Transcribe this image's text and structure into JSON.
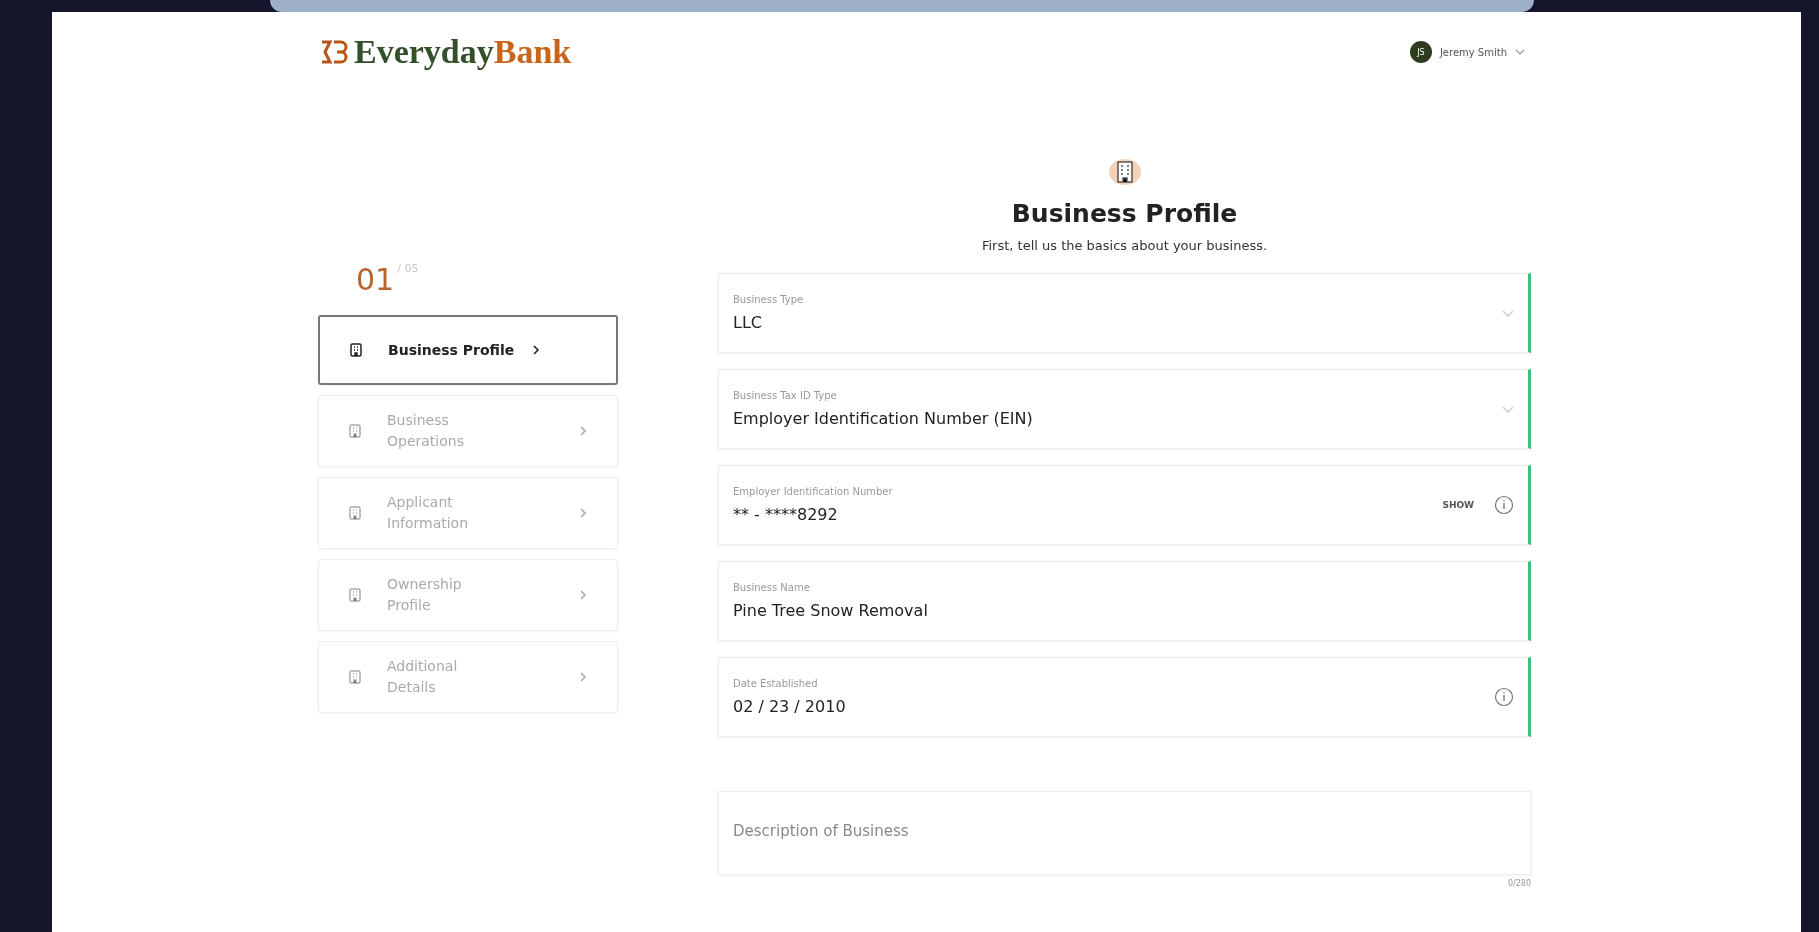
{
  "header": {
    "brand": {
      "first": "Everyday",
      "second": "Bank"
    },
    "user": {
      "initials": "JS",
      "name": "Jeremy Smith"
    }
  },
  "progress": {
    "current": "01",
    "total": "/ 05"
  },
  "steps": [
    {
      "label": "Business Profile",
      "selected": true
    },
    {
      "label": "Business Operations",
      "selected": false
    },
    {
      "label": "Applicant Information",
      "selected": false
    },
    {
      "label": "Ownership Profile",
      "selected": false
    },
    {
      "label": "Additional Details",
      "selected": false
    }
  ],
  "form": {
    "title": "Business Profile",
    "subtitle": "First, tell us the basics about your business.",
    "fields": [
      {
        "kind": "select",
        "label": "Business Type",
        "value": "LLC",
        "valid": true
      },
      {
        "kind": "select",
        "label": "Business Tax ID Type",
        "value": "Employer Identification Number (EIN)",
        "valid": true
      },
      {
        "kind": "secret",
        "label": "Employer Identification Number",
        "value": "** - ****8292",
        "action": "SHOW",
        "info": true,
        "valid": true
      },
      {
        "kind": "text",
        "label": "Business Name",
        "value": "Pine Tree Snow Removal",
        "valid": true
      },
      {
        "kind": "text",
        "label": "Date Established",
        "value": "02 / 23 / 2010",
        "info": true,
        "valid": true
      }
    ],
    "description": {
      "placeholder": "Description of Business",
      "counter": "0/280"
    }
  }
}
